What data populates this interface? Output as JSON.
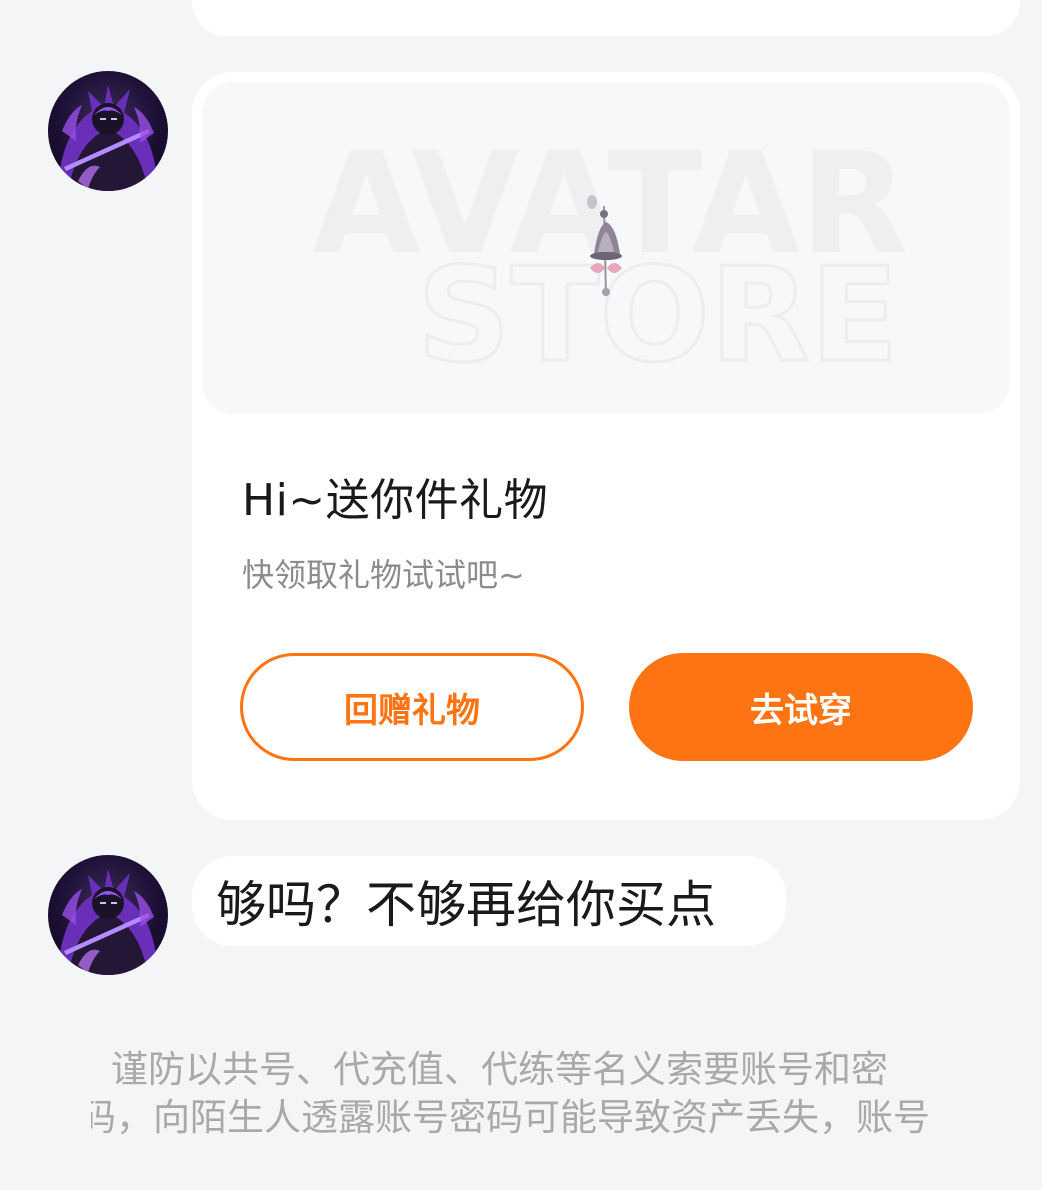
{
  "gift_card": {
    "image_watermark": {
      "line1": "AVATAR",
      "line2": "STORE"
    },
    "title": "Hi~送你件礼物",
    "subtitle": "快领取礼物试试吧~",
    "return_gift_label": "回赠礼物",
    "try_on_label": "去试穿"
  },
  "message": {
    "text": "够吗？不够再给你买点"
  },
  "notice": {
    "line1": "谨防以共号、代充值、代练等名义索要账号和密",
    "line2": "码，向陌生人透露账号密码可能导致资产丢失，账号"
  },
  "colors": {
    "accent": "#ff7412",
    "background": "#f4f5f7",
    "card": "#ffffff",
    "title_text": "#1a1a1a",
    "secondary_text": "#8c8c8c",
    "notice_text": "#a9a9a9"
  },
  "icons": {
    "avatar": "sender-avatar",
    "gift_item": "bell-charm-icon"
  }
}
